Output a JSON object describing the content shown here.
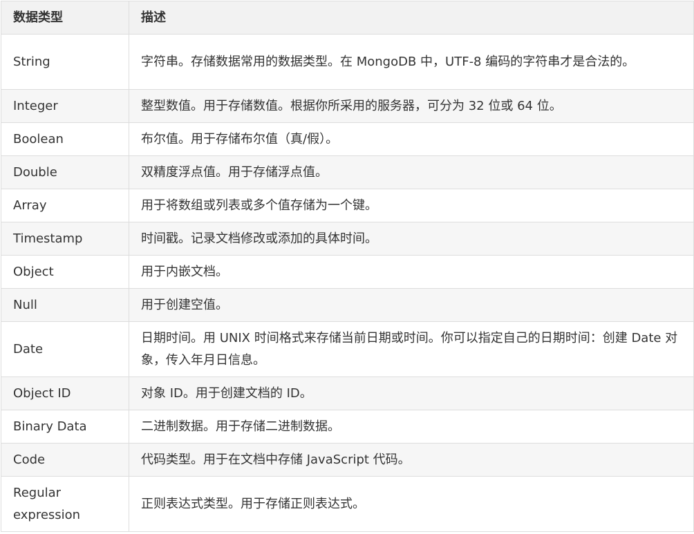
{
  "table": {
    "headers": [
      "数据类型",
      "描述"
    ],
    "rows": [
      {
        "type": "String",
        "desc": "字符串。存储数据常用的数据类型。在 MongoDB 中，UTF-8 编码的字符串才是合法的。"
      },
      {
        "type": "Integer",
        "desc": "整型数值。用于存储数值。根据你所采用的服务器，可分为 32 位或 64 位。"
      },
      {
        "type": "Boolean",
        "desc": "布尔值。用于存储布尔值（真/假）。"
      },
      {
        "type": "Double",
        "desc": "双精度浮点值。用于存储浮点值。"
      },
      {
        "type": "Array",
        "desc": "用于将数组或列表或多个值存储为一个键。"
      },
      {
        "type": "Timestamp",
        "desc": "时间戳。记录文档修改或添加的具体时间。"
      },
      {
        "type": "Object",
        "desc": "用于内嵌文档。"
      },
      {
        "type": "Null",
        "desc": "用于创建空值。"
      },
      {
        "type": "Date",
        "desc": "日期时间。用 UNIX 时间格式来存储当前日期或时间。你可以指定自己的日期时间：创建 Date 对象，传入年月日信息。"
      },
      {
        "type": "Object ID",
        "desc": "对象 ID。用于创建文档的 ID。"
      },
      {
        "type": "Binary Data",
        "desc": "二进制数据。用于存储二进制数据。"
      },
      {
        "type": "Code",
        "desc": "代码类型。用于在文档中存储 JavaScript 代码。"
      },
      {
        "type": "Regular expression",
        "desc": "正则表达式类型。用于存储正则表达式。"
      }
    ]
  }
}
